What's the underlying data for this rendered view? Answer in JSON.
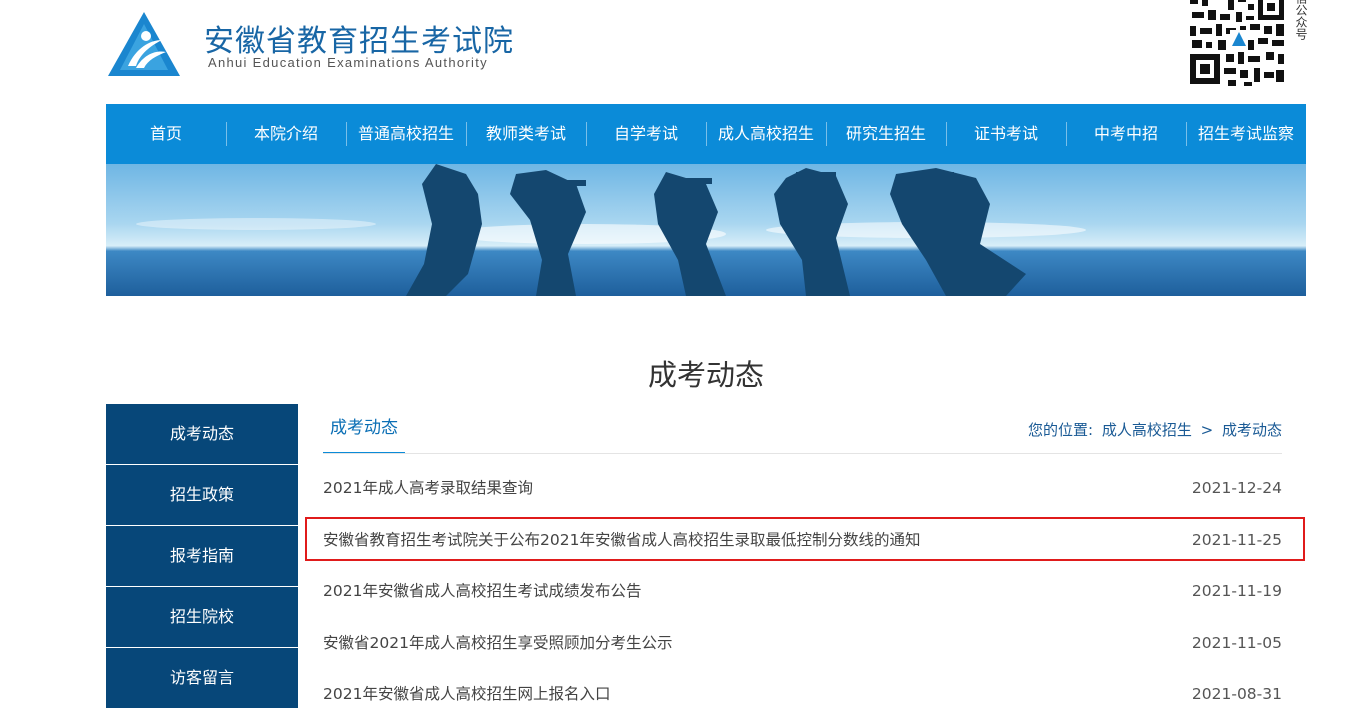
{
  "header": {
    "title": "安徽省教育招生考试院",
    "subtitle": "Anhui Education Examinations Authority",
    "qr_caption": "信公众号"
  },
  "nav": {
    "items": [
      "首页",
      "本院介绍",
      "普通高校招生",
      "教师类考试",
      "自学考试",
      "成人高校招生",
      "研究生招生",
      "证书考试",
      "中考中招",
      "招生考试监察"
    ]
  },
  "page_title": "成考动态",
  "sidebar": {
    "items": [
      "成考动态",
      "招生政策",
      "报考指南",
      "招生院校",
      "访客留言"
    ]
  },
  "content": {
    "tab": "成考动态",
    "breadcrumb": {
      "label": "您的位置:",
      "parent": "成人高校招生",
      "sep": ">",
      "current": "成考动态"
    },
    "news": [
      {
        "title": "2021年成人高考录取结果查询",
        "date": "2021-12-24"
      },
      {
        "title": "安徽省教育招生考试院关于公布2021年安徽省成人高校招生录取最低控制分数线的通知",
        "date": "2021-11-25"
      },
      {
        "title": "2021年安徽省成人高校招生考试成绩发布公告",
        "date": "2021-11-19"
      },
      {
        "title": "安徽省2021年成人高校招生享受照顾加分考生公示",
        "date": "2021-11-05"
      },
      {
        "title": "2021年安徽省成人高校招生网上报名入口",
        "date": "2021-08-31"
      }
    ]
  },
  "colors": {
    "nav_bg": "#0b8bd8",
    "sidebar_bg": "#074779",
    "highlight_border": "#e01b1b",
    "title_blue": "#1866a5"
  }
}
